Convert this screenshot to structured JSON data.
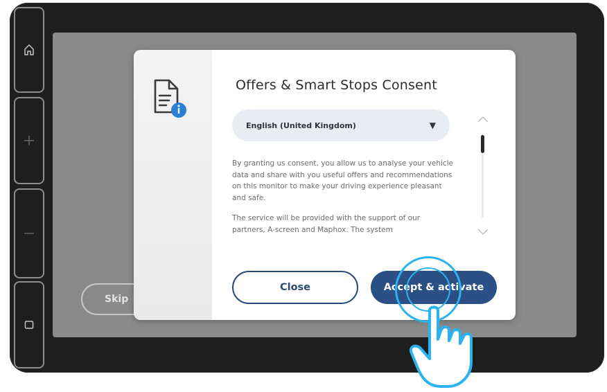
{
  "rail": {
    "icons": [
      "home-icon",
      "plus-icon",
      "minus-icon",
      "window-icon"
    ]
  },
  "background": {
    "skip_label": "Skip"
  },
  "dialog": {
    "title": "Offers & Smart Stops Consent",
    "language_select": {
      "value": "English (United Kingdom)"
    },
    "body_paragraphs": [
      "By granting us consent, you allow us to analyse your vehicle data and share with you useful offers and recommendations on this monitor to make your driving experience pleasant and safe.",
      "The service will be provided with the support of our partners, A-screen and Maphox. The system"
    ],
    "buttons": {
      "close": "Close",
      "accept": "Accept & activate"
    }
  },
  "colors": {
    "primary": "#2c4f86",
    "tap_highlight": "#2ab3ee",
    "info_badge": "#2d7fd3"
  }
}
